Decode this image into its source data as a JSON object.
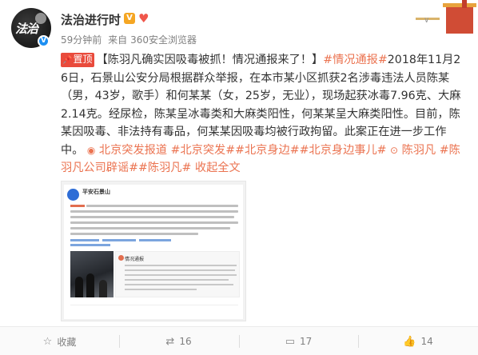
{
  "header": {
    "username": "法治进行时",
    "level_badge": "V",
    "time": "59分钟前",
    "source_prefix": "来自",
    "source": "360安全浏览器"
  },
  "post": {
    "pin_label": "置顶",
    "title": "【陈羽凡确实因吸毒被抓！情况通报来了！】",
    "topic_tag": "#情况通报#",
    "body": "2018年11月26日，石景山公安分局根据群众举报，在本市某小区抓获2名涉毒违法人员陈某（男，43岁，歌手）和何某某（女，25岁，无业），现场起获冰毒7.96克、大麻2.14克。经尿检，陈某呈冰毒类和大麻类阳性，何某某呈大麻类阳性。目前，陈某因吸毒、非法持有毒品，何某某因吸毒均被行政拘留。此案正在进一步工作中。",
    "location": "北京突发报道",
    "tags": [
      "#北京突发#",
      "#北京身边#",
      "#北京身边事儿#"
    ],
    "person": "陈羽凡",
    "tags2": [
      "#陈羽凡公司辟谣#",
      "#陈羽凡#"
    ],
    "collapse": "收起全文"
  },
  "screenshot": {
    "name": "平安石景山",
    "doc_title": "情况通报"
  },
  "actions": {
    "favorite": "收藏",
    "repost": "16",
    "comment": "17",
    "like": "14"
  },
  "colors": {
    "link": "#eb7350",
    "pin": "#e94b3c",
    "verified": "#1d8ff2"
  }
}
